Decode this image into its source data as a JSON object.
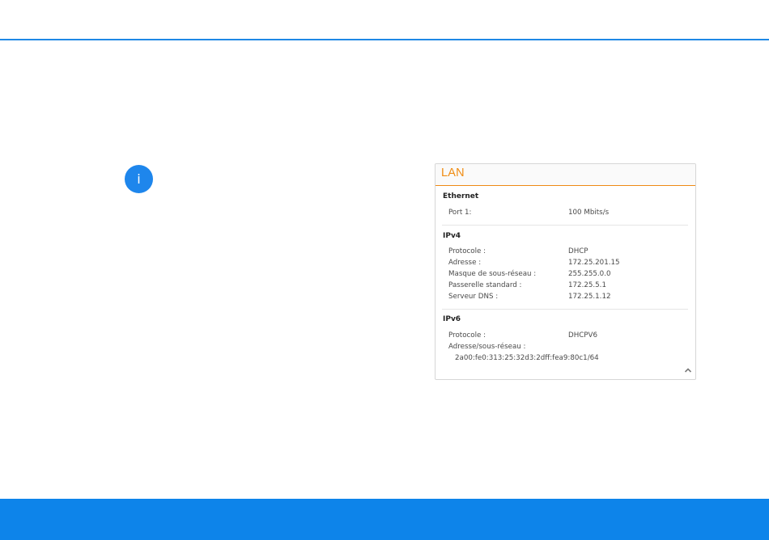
{
  "info_icon": {
    "glyph": "i",
    "color": "#1e86ec"
  },
  "accent_colors": {
    "top_rule": "#1e88e5",
    "bottom_band": "#0d84ea",
    "panel_title": "#f08c12"
  },
  "panel": {
    "title": "LAN",
    "sections": [
      {
        "title": "Ethernet",
        "rows": [
          {
            "label": "Port 1:",
            "value": "100 Mbits/s"
          }
        ]
      },
      {
        "title": "IPv4",
        "rows": [
          {
            "label": "Protocole :",
            "value": "DHCP"
          },
          {
            "label": "Adresse :",
            "value": "172.25.201.15"
          },
          {
            "label": "Masque de sous-réseau :",
            "value": "255.255.0.0"
          },
          {
            "label": "Passerelle standard :",
            "value": "172.25.5.1"
          },
          {
            "label": "Serveur DNS :",
            "value": "172.25.1.12"
          }
        ]
      },
      {
        "title": "IPv6",
        "rows": [
          {
            "label": "Protocole :",
            "value": "DHCPV6"
          },
          {
            "label": "Adresse/sous-réseau :",
            "value": ""
          }
        ],
        "sub_value": "2a00:fe0:313:25:32d3:2dff:fea9:80c1/64"
      }
    ],
    "scroll_icon": "chevron-up-icon"
  }
}
